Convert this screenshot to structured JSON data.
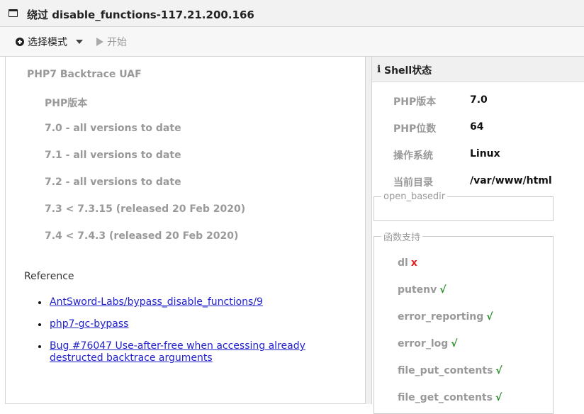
{
  "window": {
    "title": "绕过 disable_functions-117.21.200.166"
  },
  "toolbar": {
    "mode_label": "选择模式",
    "start_label": "开始"
  },
  "exploit": {
    "title": "PHP7 Backtrace UAF",
    "versions_heading": "PHP版本",
    "versions": [
      "7.0 - all versions to date",
      "7.1 - all versions to date",
      "7.2 - all versions to date",
      "7.3 < 7.3.15 (released 20 Feb 2020)",
      "7.4 < 7.4.3 (released 20 Feb 2020)"
    ],
    "reference_heading": "Reference",
    "references": [
      "AntSword-Labs/bypass_disable_functions/9",
      "php7-gc-bypass",
      "Bug #76047 Use-after-free when accessing already destructed backtrace arguments"
    ]
  },
  "shell_status": {
    "title": "Shell状态",
    "rows": [
      {
        "label": "PHP版本",
        "value": "7.0"
      },
      {
        "label": "PHP位数",
        "value": "64"
      },
      {
        "label": "操作系统",
        "value": "Linux"
      },
      {
        "label": "当前目录",
        "value": "/var/www/html"
      }
    ],
    "open_basedir_legend": "open_basedir",
    "functions_legend": "函数支持",
    "functions": [
      {
        "name": "dl",
        "mark": "x",
        "supported": false
      },
      {
        "name": "putenv",
        "mark": "√",
        "supported": true
      },
      {
        "name": "error_reporting",
        "mark": "√",
        "supported": true
      },
      {
        "name": "error_log",
        "mark": "√",
        "supported": true
      },
      {
        "name": "file_put_contents",
        "mark": "√",
        "supported": true
      },
      {
        "name": "file_get_contents",
        "mark": "√",
        "supported": true
      }
    ]
  }
}
